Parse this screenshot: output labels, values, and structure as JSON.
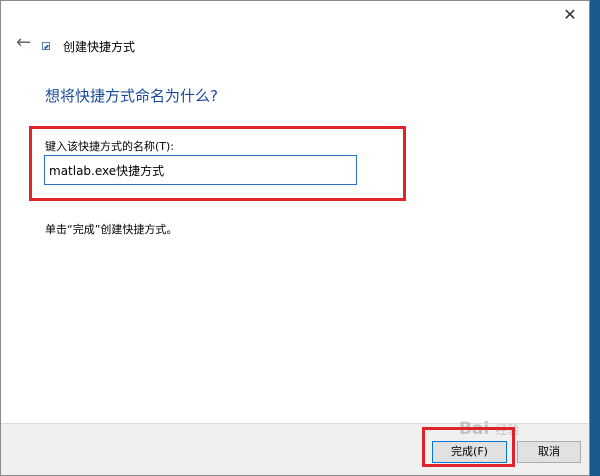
{
  "window": {
    "title": "创建快捷方式",
    "close_glyph": "✕",
    "back_glyph": "←"
  },
  "main": {
    "heading": "想将快捷方式命名为什么?",
    "field_label": "键入该快捷方式的名称(T):",
    "name_value": "matlab.exe快捷方式",
    "hint": "单击“完成”创建快捷方式。"
  },
  "footer": {
    "finish_label": "完成(F)",
    "cancel_label": "取消"
  },
  "watermark": {
    "text": "Bai",
    "sub": "经验"
  },
  "colors": {
    "heading": "#1a4a9a",
    "highlight": "#e0232b",
    "input_border": "#2a70c8",
    "desktop": "#1b5a8c"
  }
}
